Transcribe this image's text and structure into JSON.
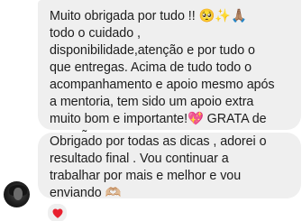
{
  "messages": [
    {
      "text": "Muito obrigada por tudo !! 🥺✨🙏🏽\ntodo o cuidado ,\ndisponibilidade,atenção e por tudo o\nque entregas. Acima de tudo todo o\nacompanhamento e apoio mesmo após\na mentoria, tem sido um apoio extra\nmuito bom e importante!💖 GRATA de\ncoração"
    },
    {
      "text": "Obrigado por todas as dicas , adorei o\nresultado final . Vou continuar a\ntrabalhar por mais e melhor e vou\nenviando 🫶🏼"
    }
  ],
  "reaction": {
    "icon": "red-heart-icon",
    "color": "#e8202e"
  },
  "colors": {
    "bubble": "#efefef",
    "text": "#1c1c1c",
    "background": "#ffffff"
  }
}
